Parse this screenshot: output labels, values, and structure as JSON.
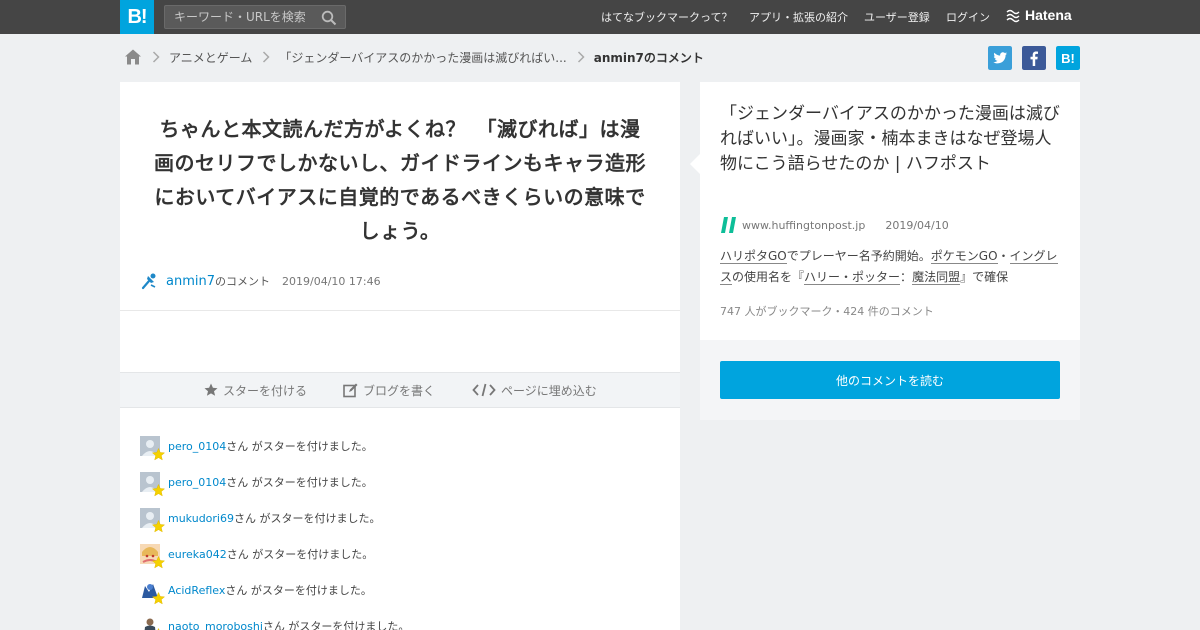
{
  "header": {
    "logo_text": "B!",
    "search_placeholder": "キーワード・URLを検索",
    "nav": [
      "はてなブックマークって？",
      "アプリ・拡張の紹介",
      "ユーザー登録",
      "ログイン"
    ],
    "brand": "Hatena",
    "accent": "#00a4de"
  },
  "breadcrumb": {
    "items": [
      "アニメとゲーム",
      "「ジェンダーバイアスのかかった漫画は滅びればい..."
    ],
    "current": "anmin7のコメント"
  },
  "share_icons": [
    "twitter-icon",
    "facebook-icon",
    "hatena-bookmark-icon"
  ],
  "comment": {
    "text": "ちゃんと本文読んだ方がよくね？　「滅びれば」は漫画のセリフでしかないし、ガイドラインもキャラ造形においてバイアスに自覚的であるべきくらいの意味でしょう。",
    "user": "anmin7",
    "user_suffix": "のコメント",
    "date": "2019/04/10 17:46"
  },
  "actions": {
    "star": "スターを付ける",
    "blog": "ブログを書く",
    "embed": "ページに埋め込む"
  },
  "stars": {
    "suffix": "さん がスターを付けました。",
    "users": [
      "pero_0104",
      "pero_0104",
      "mukudori69",
      "eureka042",
      "AcidReflex",
      "naoto_moroboshi"
    ]
  },
  "entry": {
    "title": "「ジェンダーバイアスのかかった漫画は滅びればいい」。漫画家・楠本まきはなぜ登場人物にこう語らせたのか | ハフポスト",
    "domain": "www.huffingtonpost.jp",
    "date": "2019/04/10",
    "body": {
      "p1": "ハリポタGO",
      "p2": "でプレーヤー名予約開始。",
      "p3": "ポケモンGO",
      "p4": "・",
      "p5": "イングレス",
      "p6": "の使用名を『",
      "p7": "ハリー・ポッター",
      "p8": "：",
      "p9": "魔法同盟",
      "p10": "』で確保"
    },
    "stats": "747 人がブックマーク・424 件のコメント",
    "read_more": "他のコメントを読む"
  }
}
